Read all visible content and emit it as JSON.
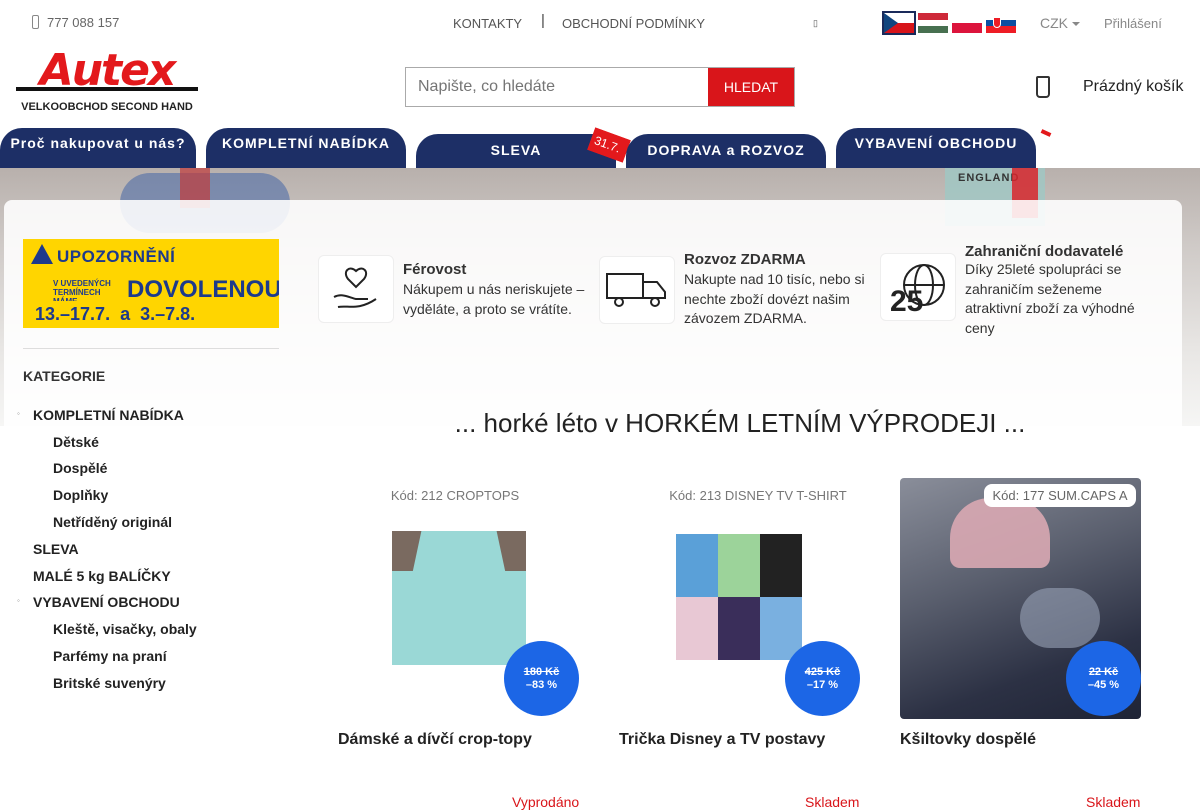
{
  "topbar": {
    "phone": "777 088 157",
    "links": [
      "KONTAKTY",
      "OBCHODNÍ PODMÍNKY"
    ],
    "separator": "|",
    "currency": "CZK",
    "login": "Přihlášení"
  },
  "logo": {
    "word": "Autex",
    "subtitle": "VELKOOBCHOD SECOND HAND"
  },
  "search": {
    "placeholder": "Napište, co hledáte",
    "button": "HLEDAT"
  },
  "cart": {
    "label": "Prázdný košík"
  },
  "nav": {
    "items": [
      "Proč nakupovat u nás?",
      "KOMPLETNÍ NABÍDKA",
      "SLEVA",
      "DOPRAVA a ROZVOZ",
      "VYBAVENÍ OBCHODU"
    ],
    "sale_tag": "31.7."
  },
  "hero": {
    "label": "ENGLAND"
  },
  "promo": {
    "headline": "UPOZORNĚNÍ",
    "note": "V UVEDENÝCH TERMÍNECH MÁME",
    "big": "DOVOLENOU",
    "dates": "13.–17.7.  a  3.–7.8."
  },
  "features": [
    {
      "title": "Férovost",
      "desc": "Nákupem u nás neriskujete – vyděláte, a proto se vrátíte."
    },
    {
      "title": "Rozvoz ZDARMA",
      "desc": "Nakupte nad 10 tisíc, nebo si nechte zboží dovézt našim závozem ZDARMA."
    },
    {
      "title": "Zahraniční dodavatelé",
      "desc": "Díky 25leté spolupráci se zahraničím seženeme atraktivní zboží za výhodné ceny",
      "icon_text": "25"
    }
  ],
  "categories": {
    "heading": "KATEGORIE",
    "items": [
      {
        "label": "KOMPLETNÍ NABÍDKA",
        "level": 0
      },
      {
        "label": "Dětské",
        "level": 1
      },
      {
        "label": "Dospělé",
        "level": 1
      },
      {
        "label": "Doplňky",
        "level": 1
      },
      {
        "label": "Netříděný originál",
        "level": 1
      },
      {
        "label": "SLEVA",
        "level": 0
      },
      {
        "label": "MALÉ 5 kg BALÍČKY",
        "level": 0
      },
      {
        "label": "VYBAVENÍ OBCHODU",
        "level": 0
      },
      {
        "label": "Kleště, visačky, obaly",
        "level": 1
      },
      {
        "label": "Parfémy na praní",
        "level": 1
      },
      {
        "label": "Britské suvenýry",
        "level": 1
      }
    ]
  },
  "promo_title": "... horké léto v HORKÉM LETNÍM VÝPRODEJI ...",
  "products": [
    {
      "code": "Kód: 212 CROPTOPS",
      "old_price": "180 Kč",
      "discount": "–83 %",
      "name": "Dámské a dívčí crop-topy",
      "more": "Vyprodáno"
    },
    {
      "code": "Kód: 213 DISNEY TV T-SHIRT",
      "old_price": "425 Kč",
      "discount": "–17 %",
      "name": "Trička Disney a TV postavy",
      "more": "Skladem"
    },
    {
      "code": "Kód: 177 SUM.CAPS A",
      "old_price": "22 Kč",
      "discount": "–45 %",
      "name": "Kšiltovky dospělé",
      "more": "Skladem"
    }
  ],
  "colors": {
    "brand_red": "#e3191c",
    "nav_blue": "#1d2f66",
    "badge_blue": "#1c66e6"
  }
}
